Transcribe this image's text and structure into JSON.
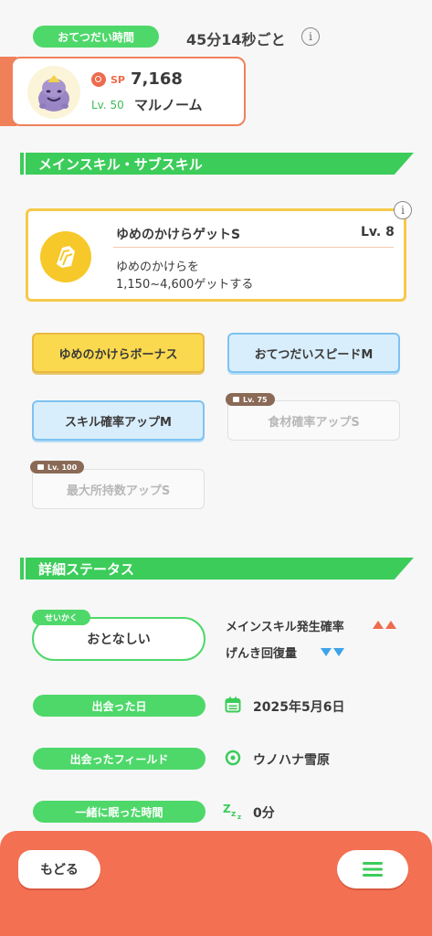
{
  "help": {
    "label": "おてつだい時間",
    "value": "45分14秒ごと",
    "info_glyph": "i"
  },
  "pokemon": {
    "sp_label": "SP",
    "sp_value": "7,168",
    "level": "Lv. 50",
    "name": "マルノーム"
  },
  "sections": {
    "skills": "メインスキル・サブスキル",
    "details": "詳細ステータス"
  },
  "main_skill": {
    "name": "ゆめのかけらゲットS",
    "level": "Lv. 8",
    "desc_line1": "ゆめのかけらを",
    "desc_line2": "1,150~4,600ゲットする",
    "info_glyph": "i"
  },
  "sub_skills": [
    {
      "label": "ゆめのかけらボーナス",
      "style": "gold",
      "locked": false
    },
    {
      "label": "おてつだいスピードM",
      "style": "blue",
      "locked": false
    },
    {
      "label": "スキル確率アップM",
      "style": "blue",
      "locked": false
    },
    {
      "label": "食材確率アップS",
      "style": "locked",
      "locked": true,
      "unlock": "Lv. 75"
    },
    {
      "label": "最大所持数アップS",
      "style": "locked",
      "locked": true,
      "unlock": "Lv. 100"
    }
  ],
  "nature": {
    "tag": "せいかく",
    "name": "おとなしい",
    "up_effect": "メインスキル発生確率",
    "down_effect": "げんき回復量"
  },
  "info_rows": [
    {
      "label": "出会った日",
      "value": "2025年5月6日",
      "icon": "calendar-icon"
    },
    {
      "label": "出会ったフィールド",
      "value": "ウノハナ雪原",
      "icon": "location-pin-icon"
    },
    {
      "label": "一緒に眠った時間",
      "value": "0分",
      "icon": "sleep-zzz-icon"
    }
  ],
  "nav": {
    "back": "もどる"
  },
  "colors": {
    "accent_green": "#4ed86a",
    "card_orange": "#f0805a",
    "bottom_bar": "#f37052",
    "skill_gold": "#f7c829"
  }
}
